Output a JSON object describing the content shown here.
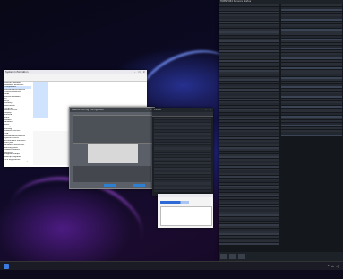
{
  "taskbar": {
    "tray_icons": [
      "chevron-up-icon",
      "network-icon",
      "volume-icon"
    ],
    "clock_time": "",
    "clock_date": ""
  },
  "sysinfo_window": {
    "title": "System Information",
    "tree": [
      "System Summary",
      "Hardware Resources",
      "Components",
      "Software Environment",
      "Conflicts/Sharing",
      "DMA",
      "Forced Hardware",
      "I/O",
      "IRQs",
      "Memory",
      "Multimedia",
      "CD-ROM",
      "Sound Device",
      "Display",
      "Infrared",
      "Input",
      "Modem",
      "Network",
      "Ports",
      "Storage",
      "Printing",
      "Problem Devices",
      "USB",
      "Software Environment",
      "System Drivers",
      "Environment Variables",
      "Print Jobs",
      "Network Connections",
      "Running Tasks",
      "Loaded Modules",
      "Services",
      "Program Groups",
      "Startup Programs",
      "OLE Registration",
      "Windows Error Reporting"
    ]
  },
  "memory_window": {
    "title": "ASRock Timing Configurator",
    "status_lines": []
  },
  "cpu_window": {
    "title": "CPU-Z"
  },
  "small_window": {
    "title": "",
    "fields": []
  },
  "hwinfo_window": {
    "title": "HWiNFO64 Sensors Status"
  }
}
